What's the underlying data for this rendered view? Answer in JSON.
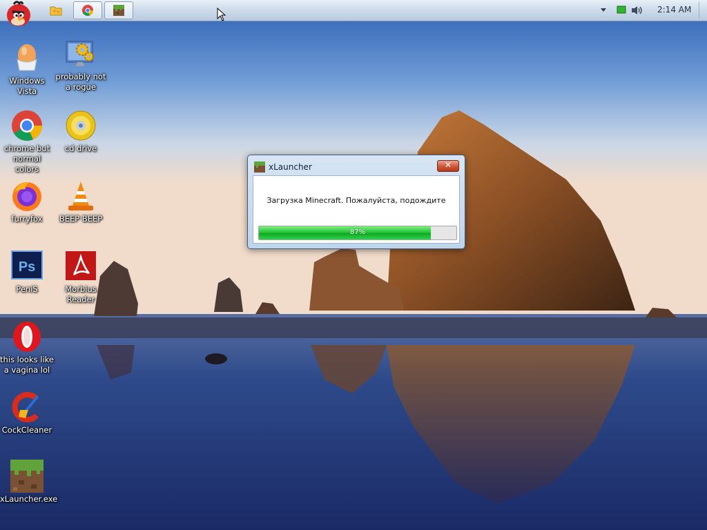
{
  "taskbar": {
    "start_button": "angry-bird-start",
    "pinned": [
      {
        "name": "explorer",
        "icon": "folder-icon"
      },
      {
        "name": "chrome",
        "icon": "chrome-icon"
      },
      {
        "name": "xlauncher",
        "icon": "minecraft-grass-icon"
      }
    ],
    "clock": "2:14 AM"
  },
  "desktop_icons": [
    {
      "id": "windows-vista",
      "label": "Windows\nVista",
      "icon": "egg-icon"
    },
    {
      "id": "probably-not-a-rogue",
      "label": "probably not\na rogue",
      "icon": "gears-icon"
    },
    {
      "id": "chrome-but-normal-colors",
      "label": "chrome but\nnormal colors",
      "icon": "chrome-icon"
    },
    {
      "id": "cd-drive",
      "label": "cd drive",
      "icon": "cd-icon"
    },
    {
      "id": "furryfox",
      "label": "furryfox",
      "icon": "firefox-icon"
    },
    {
      "id": "beep-beep",
      "label": "BEEP BEEP",
      "icon": "vlc-cone-icon"
    },
    {
      "id": "penis",
      "label": "PeniS",
      "icon": "photoshop-icon"
    },
    {
      "id": "morbius-reader",
      "label": "Morbius\nReader",
      "icon": "pdf-reader-icon"
    },
    {
      "id": "opera",
      "label": "this looks like\na vagina lol",
      "icon": "opera-icon"
    },
    {
      "id": "cockcleaner",
      "label": "CockCleaner",
      "icon": "ccleaner-icon"
    },
    {
      "id": "xlauncher-exe",
      "label": "xLauncher.exe",
      "icon": "minecraft-grass-icon"
    }
  ],
  "dialog": {
    "title": "xLauncher",
    "message": "Загрузка Minecraft. Пожалуйста, подождите",
    "progress_percent": 87,
    "progress_text": "87%"
  },
  "colors": {
    "progress_green": "#12a826",
    "close_red": "#c8442a",
    "taskbar": "#cfdceb"
  }
}
